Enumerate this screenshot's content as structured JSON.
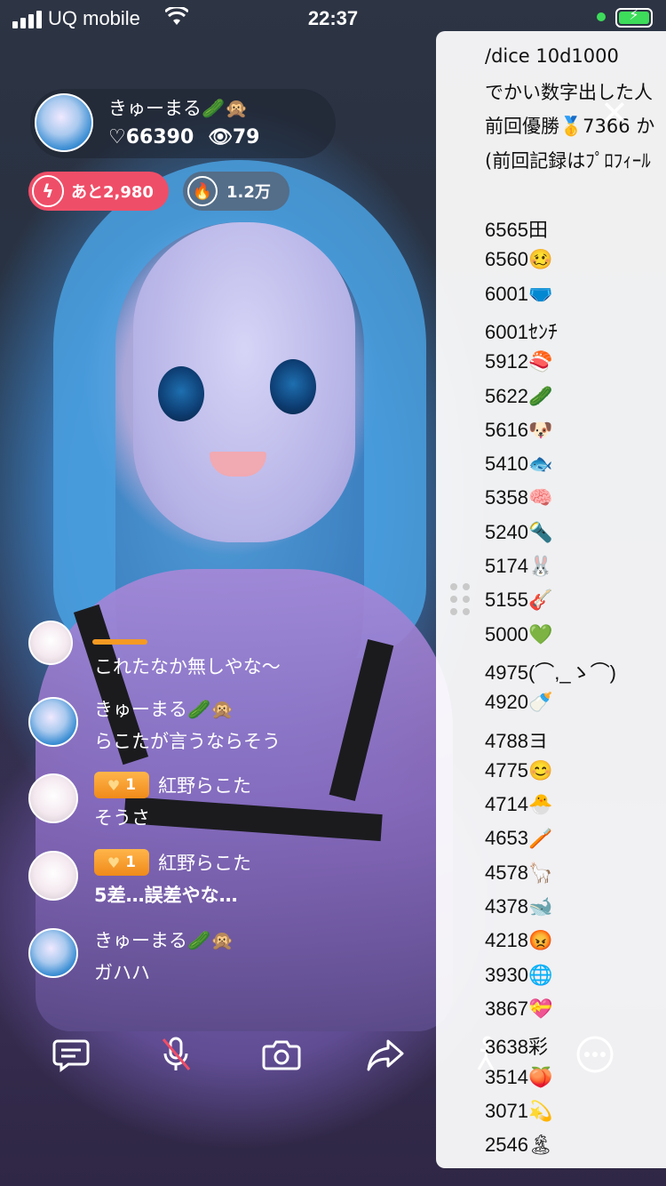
{
  "status_bar": {
    "carrier": "UQ mobile",
    "time": "22:37",
    "wifi_icon": "wifi-icon",
    "battery_icon": "battery-charging-icon"
  },
  "host": {
    "name": "きゅーまる🥒🙊",
    "likes": "♡66390",
    "viewers": "👁79"
  },
  "pills": {
    "remain_label": "あと2,980",
    "fire_label": "1.2万"
  },
  "comments": [
    {
      "name": "",
      "badge": "",
      "text": "これたなか無しやな～"
    },
    {
      "name": "きゅーまる🥒🙊",
      "badge": "",
      "text": "らこたが言うならそう"
    },
    {
      "name": "紅野らこた",
      "badge": "1",
      "text": "そうさ"
    },
    {
      "name": "紅野らこた",
      "badge": "1",
      "text": "5差…誤差やな…"
    },
    {
      "name": "きゅーまる🥒🙊",
      "badge": "",
      "text": "ガハハ"
    }
  ],
  "toolbar": [
    "comment-icon",
    "mic-muted-icon",
    "camera-icon",
    "share-icon",
    "pose-icon",
    "more-icon"
  ],
  "dice": {
    "header": [
      "/dice 10d1000",
      "でかい数字出した人",
      "前回優勝🥇7366 か",
      "(前回記録はﾌﾟﾛﾌｨｰﾙ"
    ],
    "results": [
      "6565田",
      "6560🥴",
      "6001🩲",
      "6001ｾﾝﾁ",
      "5912🍣",
      "5622🥒",
      "5616🐶",
      "5410🐟",
      "5358🧠",
      "5240🔦",
      "5174🐰",
      "5155🎸",
      "5000💚",
      "4975(⌒,_ゝ⌒)",
      "4920🍼",
      "4788ヨ",
      "4775😊",
      "4714🐣",
      "4653🪥",
      "4578🦙",
      "4378🐋",
      "4218😡",
      "3930🌐",
      "3867💝",
      "3638彩",
      "3514🍑",
      "3071💫",
      "2546🏝"
    ],
    "close_icon": "close-icon"
  }
}
